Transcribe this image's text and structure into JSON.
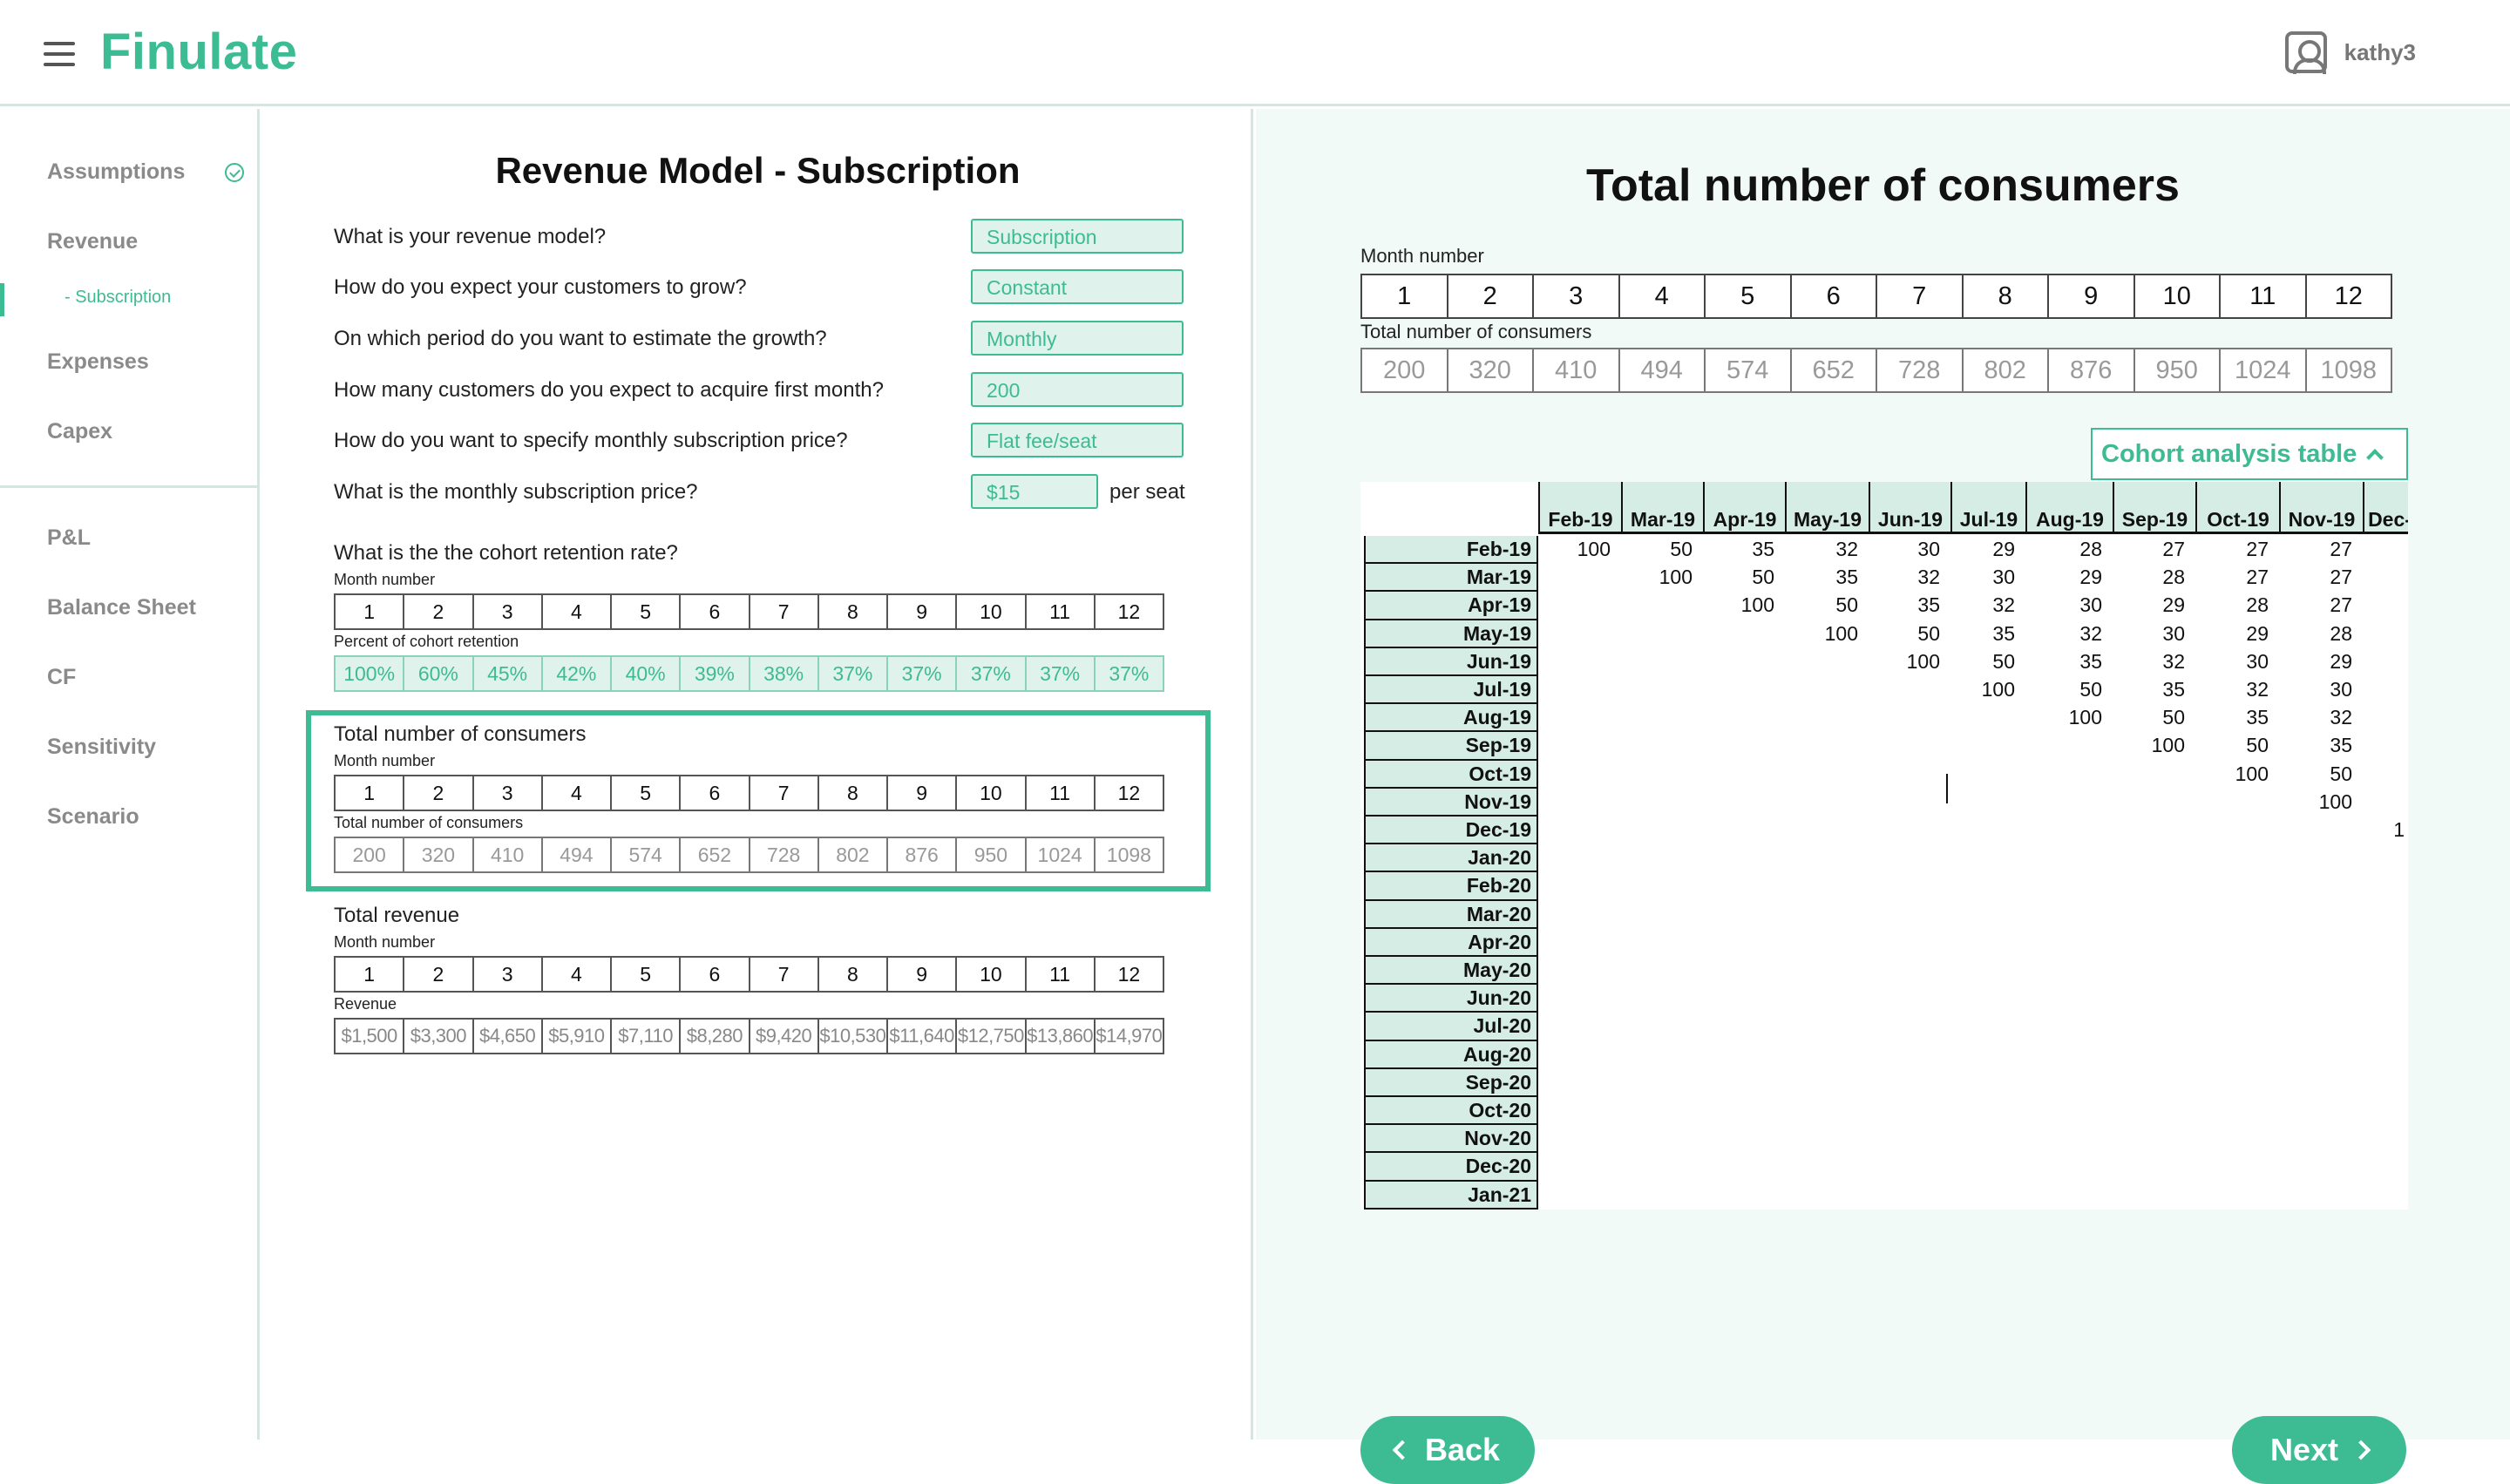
{
  "header": {
    "app_name": "Finulate",
    "username": "kathy3"
  },
  "sidebar": {
    "items": [
      {
        "label": "Assumptions"
      },
      {
        "label": "Revenue"
      },
      {
        "label": "- Subscription"
      },
      {
        "label": "Expenses"
      },
      {
        "label": "Capex"
      },
      {
        "label": "P&L"
      },
      {
        "label": "Balance Sheet"
      },
      {
        "label": "CF"
      },
      {
        "label": "Sensitivity"
      },
      {
        "label": "Scenario"
      }
    ]
  },
  "middle": {
    "title": "Revenue Model - Subscription",
    "questions": [
      {
        "q": "What is your revenue model?",
        "a": "Subscription"
      },
      {
        "q": "How do you expect your customers to grow?",
        "a": "Constant"
      },
      {
        "q": "On which period do you want to estimate the growth?",
        "a": "Monthly"
      },
      {
        "q": "How many customers do you expect to acquire first month?",
        "a": "200"
      },
      {
        "q": "How do you want to specify monthly subscription price?",
        "a": "Flat fee/seat"
      },
      {
        "q": "What is the monthly subscription price?",
        "a": "$15",
        "suffix": "per seat"
      }
    ],
    "retention": {
      "title": "What is the the cohort retention rate?",
      "month_label": "Month number",
      "value_label": "Percent of cohort retention",
      "months": [
        "1",
        "2",
        "3",
        "4",
        "5",
        "6",
        "7",
        "8",
        "9",
        "10",
        "11",
        "12"
      ],
      "values": [
        "100%",
        "60%",
        "45%",
        "42%",
        "40%",
        "39%",
        "38%",
        "37%",
        "37%",
        "37%",
        "37%",
        "37%"
      ]
    },
    "consumers": {
      "title": "Total number of consumers",
      "month_label": "Month number",
      "value_label": "Total number of consumers",
      "months": [
        "1",
        "2",
        "3",
        "4",
        "5",
        "6",
        "7",
        "8",
        "9",
        "10",
        "11",
        "12"
      ],
      "values": [
        "200",
        "320",
        "410",
        "494",
        "574",
        "652",
        "728",
        "802",
        "876",
        "950",
        "1024",
        "1098"
      ]
    },
    "revenue": {
      "title": "Total revenue",
      "month_label": "Month number",
      "value_label": "Revenue",
      "months": [
        "1",
        "2",
        "3",
        "4",
        "5",
        "6",
        "7",
        "8",
        "9",
        "10",
        "11",
        "12"
      ],
      "values": [
        "$1,500",
        "$3,300",
        "$4,650",
        "$5,910",
        "$7,110",
        "$8,280",
        "$9,420",
        "$10,530",
        "$11,640",
        "$12,750",
        "$13,860",
        "$14,970"
      ]
    }
  },
  "right": {
    "title": "Total number of consumers",
    "month_label": "Month number",
    "value_label": "Total number of consumers",
    "months": [
      "1",
      "2",
      "3",
      "4",
      "5",
      "6",
      "7",
      "8",
      "9",
      "10",
      "11",
      "12"
    ],
    "values": [
      "200",
      "320",
      "410",
      "494",
      "574",
      "652",
      "728",
      "802",
      "876",
      "950",
      "1024",
      "1098"
    ],
    "cohort_button": "Cohort analysis table",
    "cohort": {
      "columns": [
        "Feb-19",
        "Mar-19",
        "Apr-19",
        "May-19",
        "Jun-19",
        "Jul-19",
        "Aug-19",
        "Sep-19",
        "Oct-19",
        "Nov-19",
        "Dec-"
      ],
      "rows": [
        "Feb-19",
        "Mar-19",
        "Apr-19",
        "May-19",
        "Jun-19",
        "Jul-19",
        "Aug-19",
        "Sep-19",
        "Oct-19",
        "Nov-19",
        "Dec-19",
        "Jan-20",
        "Feb-20",
        "Mar-20",
        "Apr-20",
        "May-20",
        "Jun-20",
        "Jul-20",
        "Aug-20",
        "Sep-20",
        "Oct-20",
        "Nov-20",
        "Dec-20",
        "Jan-21"
      ],
      "values": [
        [
          "100",
          "50",
          "35",
          "32",
          "30",
          "29",
          "28",
          "27",
          "27",
          "27"
        ],
        [
          "",
          "100",
          "50",
          "35",
          "32",
          "30",
          "29",
          "28",
          "27",
          "27"
        ],
        [
          "",
          "",
          "100",
          "50",
          "35",
          "32",
          "30",
          "29",
          "28",
          "27"
        ],
        [
          "",
          "",
          "",
          "100",
          "50",
          "35",
          "32",
          "30",
          "29",
          "28"
        ],
        [
          "",
          "",
          "",
          "",
          "100",
          "50",
          "35",
          "32",
          "30",
          "29"
        ],
        [
          "",
          "",
          "",
          "",
          "",
          "100",
          "50",
          "35",
          "32",
          "30"
        ],
        [
          "",
          "",
          "",
          "",
          "",
          "",
          "100",
          "50",
          "35",
          "32"
        ],
        [
          "",
          "",
          "",
          "",
          "",
          "",
          "",
          "100",
          "50",
          "35"
        ],
        [
          "",
          "",
          "",
          "",
          "",
          "",
          "",
          "",
          "100",
          "50"
        ],
        [
          "",
          "",
          "",
          "",
          "",
          "",
          "",
          "",
          "",
          "100"
        ],
        [
          "",
          "",
          "",
          "",
          "",
          "",
          "",
          "",
          "",
          "",
          "1"
        ]
      ]
    },
    "back_label": "Back",
    "next_label": "Next"
  }
}
